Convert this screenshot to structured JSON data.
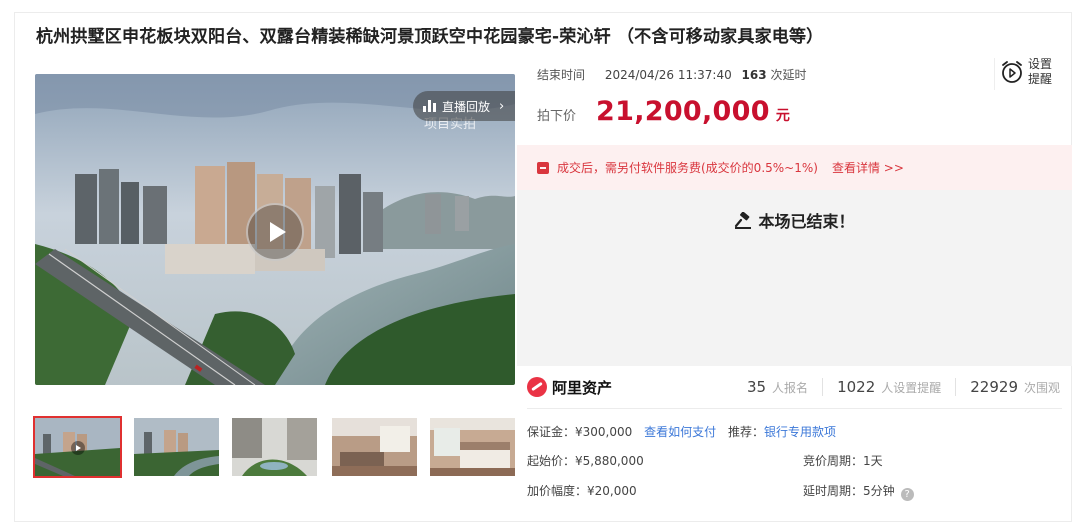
{
  "title": "杭州拱墅区申花板块双阳台、双露台精装稀缺河景顶跃空中花园豪宅-荣沁轩 （不含可移动家具家电等）",
  "gallery": {
    "live_label": "直播回放",
    "live_chevron": "›",
    "caption": "项目实拍",
    "thumbnails": [
      "video-thumb",
      "aerial-thumb",
      "courtyard-thumb",
      "living-room-thumb",
      "bedroom-thumb"
    ]
  },
  "auction": {
    "end_label": "结束时间",
    "end_value": "2024/04/26 11:37:40",
    "delay_count": "163",
    "delay_unit": "次延时",
    "remind_label": "设置提醒",
    "price_label": "拍下价",
    "price": "21,200,000",
    "price_unit": "元",
    "notice_text": "成交后，需另付软件服务费(成交价的0.5%~1%)",
    "notice_link": "查看详情 >>",
    "ended_text": "本场已结束！"
  },
  "platform": {
    "name": "阿里资产",
    "signups": "35",
    "signups_unit": "人报名",
    "reminders": "1022",
    "reminders_unit": "人设置提醒",
    "views": "22929",
    "views_unit": "次围观"
  },
  "details": {
    "deposit": "保证金：¥300,000",
    "deposit_link": "查看如何支付",
    "recommend_label": "推荐：",
    "recommend_link": "银行专用款项",
    "start_price": "起始价：¥5,880,000",
    "bid_cycle": "竞价周期：1天",
    "increment": "加价幅度：¥20,000",
    "delay_cycle": "延时周期：5分钟"
  },
  "colors": {
    "price_red": "#c8102e",
    "notice_bg": "#fdf0f0",
    "link_blue": "#3c78d8"
  }
}
